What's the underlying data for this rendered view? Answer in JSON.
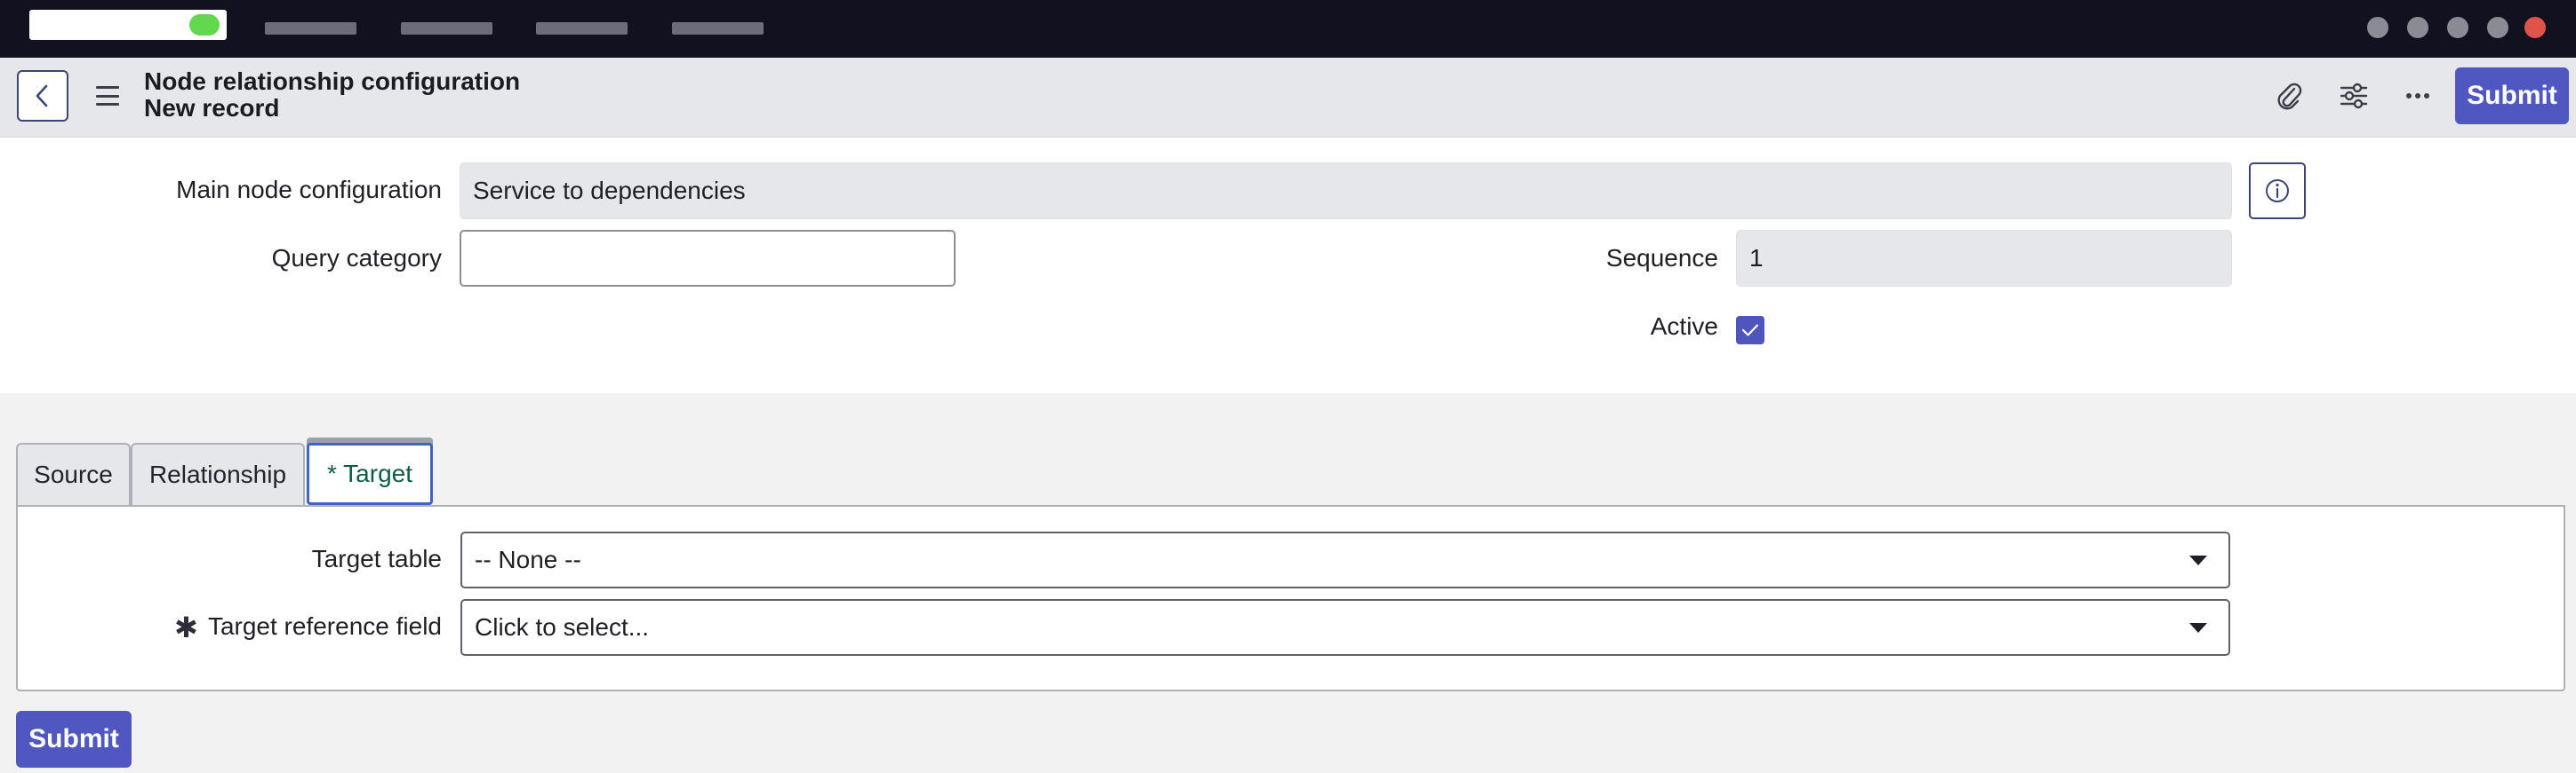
{
  "header": {
    "title": "Node relationship configuration",
    "subtitle": "New record",
    "submit_label": "Submit"
  },
  "form": {
    "main_node_label": "Main node configuration",
    "main_node_value": "Service to dependencies",
    "query_category_label": "Query category",
    "query_category_value": "",
    "sequence_label": "Sequence",
    "sequence_value": "1",
    "active_label": "Active",
    "active_checked": true
  },
  "tabs": [
    {
      "label": "Source",
      "active": false
    },
    {
      "label": "Relationship",
      "active": false
    },
    {
      "label": "*  Target",
      "active": true
    }
  ],
  "target_tab": {
    "target_table_label": "Target table",
    "target_table_value": "-- None --",
    "target_reference_label": "Target reference field",
    "target_reference_value": "Click to select...",
    "mandatory_mark": "✱"
  },
  "footer": {
    "submit_label": "Submit"
  },
  "icons": {
    "back": "chevron-left-icon",
    "menu": "hamburger-icon",
    "attachment": "paperclip-icon",
    "settings": "sliders-icon",
    "more": "ellipsis-icon",
    "info": "info-icon",
    "check": "check-icon",
    "dropdown": "caret-down-icon"
  },
  "colors": {
    "topbar": "#11111f",
    "accent": "#5057c0",
    "header_bg": "#e6e7ea",
    "active_tab_border": "#3f63c9",
    "active_tab_text": "#0d5c4a"
  }
}
